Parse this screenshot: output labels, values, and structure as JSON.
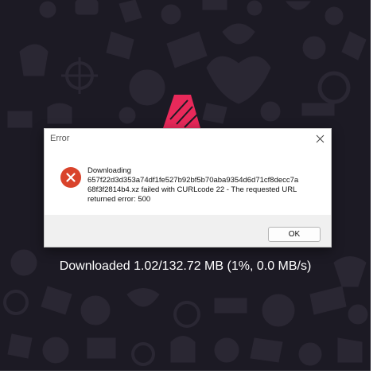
{
  "app": {
    "progress_text": "Downloaded 1.02/132.72 MB (1%, 0.0 MB/s)",
    "background_color": "#1c1a24",
    "doodle_color": "#2a2733",
    "logo_color": "#e8295a"
  },
  "dialog": {
    "title": "Error",
    "close_icon": "close-icon",
    "error_icon": "error-icon",
    "message": "Downloading\n657f22d3d353a74df1fe527b92bf5b70aba9354d6d71cf8decc7a\n68f3f2814b4.xz failed with CURLcode 22 - The requested URL\nreturned error: 500",
    "ok_label": "OK",
    "accent_error": "#d9432b"
  }
}
